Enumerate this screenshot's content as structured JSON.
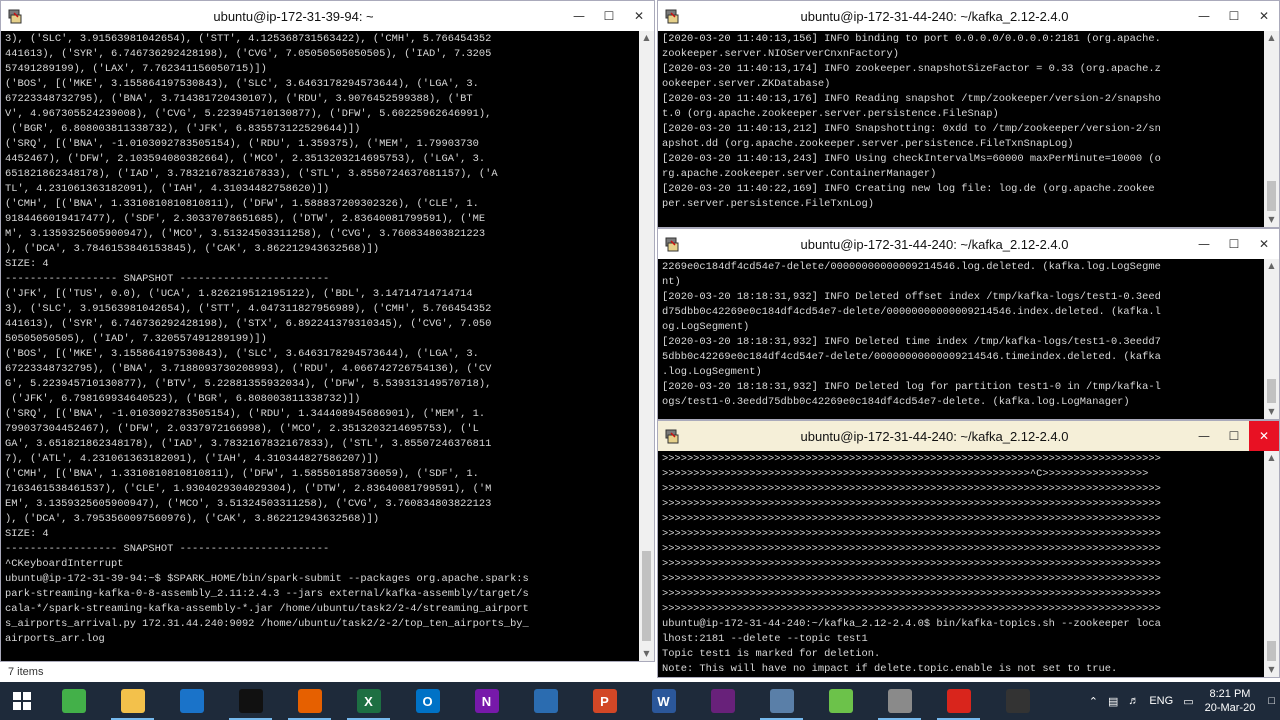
{
  "colors": {
    "terminal_bg": "#000000",
    "terminal_text": "#d9d9d9",
    "cursor": "#00e600",
    "taskbar": "#1e2a3a",
    "close_red": "#e81123",
    "active_title": "#f5efd8"
  },
  "window_left": {
    "title": "ubuntu@ip-172-31-39-94: ~",
    "icon": "putty-icon",
    "lines": [
      "3), ('SLC', 3.91563981042654), ('STT', 4.125368731563422), ('CMH', 5.766454352",
      "441613), ('SYR', 6.746736292428198), ('CVG', 7.05050505050505), ('IAD', 7.3205",
      "57491289199), ('LAX', 7.762341156050715)])",
      "('BOS', [('MKE', 3.155864197530843), ('SLC', 3.6463178294573644), ('LGA', 3.",
      "67223348732795), ('BNA', 3.714381720430107), ('RDU', 3.9076452599388), ('BT",
      "V', 4.967305524239008), ('CVG', 5.223945710130877), ('DFW', 5.60225962646991),",
      " ('BGR', 6.808003811338732), ('JFK', 6.835573122529644)])",
      "('SRQ', [('BNA', -1.0103092783505154), ('RDU', 1.359375), ('MEM', 1.79903730",
      "4452467), ('DFW', 2.103594080382664), ('MCO', 2.3513203214695753), ('LGA', 3.",
      "651821862348178), ('IAD', 3.7832167832167833), ('STL', 3.8550724637681157), ('A",
      "TL', 4.231061363182091), ('IAH', 4.31034482758620)])",
      "('CMH', [('BNA', 1.3310810810810811), ('DFW', 1.588837209302326), ('CLE', 1.",
      "9184466019417477), ('SDF', 2.30337078651685), ('DTW', 2.83640081799591), ('ME",
      "M', 3.1359325605900947), ('MCO', 3.51324503311258), ('CVG', 3.760834803821223",
      "), ('DCA', 3.7846153846153845), ('CAK', 3.862212943632568)])",
      "SIZE: 4",
      "------------------ SNAPSHOT ------------------------",
      "('JFK', [('TUS', 0.0), ('UCA', 1.826219512195122), ('BDL', 3.14714714714714",
      "3), ('SLC', 3.91563981042654), ('STT', 4.047311827956989), ('CMH', 5.766454352",
      "441613), ('SYR', 6.746736292428198), ('STX', 6.892241379310345), ('CVG', 7.050",
      "50505050505), ('IAD', 7.320557491289199)])",
      "('BOS', [('MKE', 3.155864197530843), ('SLC', 3.6463178294573644), ('LGA', 3.",
      "67223348732795), ('BNA', 3.7188093730208993), ('RDU', 4.066742726754136), ('CV",
      "G', 5.223945710130877), ('BTV', 5.22881355932034), ('DFW', 5.539313149570718),",
      " ('JFK', 6.798169934640523), ('BGR', 6.808003811338732)])",
      "('SRQ', [('BNA', -1.0103092783505154), ('RDU', 1.344408945686901), ('MEM', 1.",
      "799037304452467), ('DFW', 2.0337972166998), ('MCO', 2.3513203214695753), ('L",
      "GA', 3.651821862348178), ('IAD', 3.7832167832167833), ('STL', 3.85507246376811",
      "7), ('ATL', 4.231061363182091), ('IAH', 4.310344827586207)])",
      "('CMH', [('BNA', 1.3310810810810811), ('DFW', 1.585501858736059), ('SDF', 1.",
      "7163461538461537), ('CLE', 1.9304029304029304), ('DTW', 2.83640081799591), ('M",
      "EM', 3.1359325605900947), ('MCO', 3.51324503311258), ('CVG', 3.760834803822123",
      "), ('DCA', 3.7953560097560976), ('CAK', 3.862212943632568)])",
      "SIZE: 4",
      "------------------ SNAPSHOT ------------------------",
      "^CKeyboardInterrupt",
      "ubuntu@ip-172-31-39-94:~$ $SPARK_HOME/bin/spark-submit --packages org.apache.spark:s",
      "park-streaming-kafka-0-8-assembly_2.11:2.4.3 --jars external/kafka-assembly/target/s",
      "cala-*/spark-streaming-kafka-assembly-*.jar /home/ubuntu/task2/2-4/streaming_airport",
      "s_airports_arrival.py 172.31.44.240:9092 /home/ubuntu/task2/2-2/top_ten_airports_by_",
      "airports_arr.log"
    ]
  },
  "window_zk": {
    "title": "ubuntu@ip-172-31-44-240: ~/kafka_2.12-2.4.0",
    "lines": [
      "[2020-03-20 11:40:13,156] INFO binding to port 0.0.0.0/0.0.0.0:2181 (org.apache.",
      "zookeeper.server.NIOServerCnxnFactory)",
      "[2020-03-20 11:40:13,174] INFO zookeeper.snapshotSizeFactor = 0.33 (org.apache.z",
      "ookeeper.server.ZKDatabase)",
      "[2020-03-20 11:40:13,176] INFO Reading snapshot /tmp/zookeeper/version-2/snapsho",
      "t.0 (org.apache.zookeeper.server.persistence.FileSnap)",
      "[2020-03-20 11:40:13,212] INFO Snapshotting: 0xdd to /tmp/zookeeper/version-2/sn",
      "apshot.dd (org.apache.zookeeper.server.persistence.FileTxnSnapLog)",
      "[2020-03-20 11:40:13,243] INFO Using checkIntervalMs=60000 maxPerMinute=10000 (o",
      "rg.apache.zookeeper.server.ContainerManager)",
      "[2020-03-20 11:40:22,169] INFO Creating new log file: log.de (org.apache.zookee",
      "per.server.persistence.FileTxnLog)"
    ]
  },
  "window_kafka": {
    "title": "ubuntu@ip-172-31-44-240: ~/kafka_2.12-2.4.0",
    "lines": [
      "2269e0c184df4cd54e7-delete/00000000000009214546.log.deleted. (kafka.log.LogSegme",
      "nt)",
      "[2020-03-20 18:18:31,932] INFO Deleted offset index /tmp/kafka-logs/test1-0.3eed",
      "d75dbb0c42269e0c184df4cd54e7-delete/00000000000009214546.index.deleted. (kafka.l",
      "og.LogSegment)",
      "[2020-03-20 18:18:31,932] INFO Deleted time index /tmp/kafka-logs/test1-0.3eedd7",
      "5dbb0c42269e0c184df4cd54e7-delete/00000000000009214546.timeindex.deleted. (kafka",
      ".log.LogSegment)",
      "[2020-03-20 18:18:31,932] INFO Deleted log for partition test1-0 in /tmp/kafka-l",
      "ogs/test1-0.3eedd75dbb0c42269e0c184df4cd54e7-delete. (kafka.log.LogManager)"
    ]
  },
  "window_topics": {
    "title": "ubuntu@ip-172-31-44-240: ~/kafka_2.12-2.4.0",
    "lines": [
      ">>>>>>>>>>>>>>>>>>>>>>>>>>>>>>>>>>>>>>>>>>>>>>>>>>>>>>>>>>>>>>>>>>>>>>>>>>>>>>>>",
      ">>>>>>>>>>>>>>>>>>>>>>>>>>>>>>>>>>>>>>>>>>>>>>>>>>>>>>>>>>>^C>>>>>>>>>>>>>>>>>",
      ">>>>>>>>>>>>>>>>>>>>>>>>>>>>>>>>>>>>>>>>>>>>>>>>>>>>>>>>>>>>>>>>>>>>>>>>>>>>>>>>",
      ">>>>>>>>>>>>>>>>>>>>>>>>>>>>>>>>>>>>>>>>>>>>>>>>>>>>>>>>>>>>>>>>>>>>>>>>>>>>>>>>",
      ">>>>>>>>>>>>>>>>>>>>>>>>>>>>>>>>>>>>>>>>>>>>>>>>>>>>>>>>>>>>>>>>>>>>>>>>>>>>>>>>",
      ">>>>>>>>>>>>>>>>>>>>>>>>>>>>>>>>>>>>>>>>>>>>>>>>>>>>>>>>>>>>>>>>>>>>>>>>>>>>>>>>",
      ">>>>>>>>>>>>>>>>>>>>>>>>>>>>>>>>>>>>>>>>>>>>>>>>>>>>>>>>>>>>>>>>>>>>>>>>>>>>>>>>",
      ">>>>>>>>>>>>>>>>>>>>>>>>>>>>>>>>>>>>>>>>>>>>>>>>>>>>>>>>>>>>>>>>>>>>>>>>>>>>>>>>",
      ">>>>>>>>>>>>>>>>>>>>>>>>>>>>>>>>>>>>>>>>>>>>>>>>>>>>>>>>>>>>>>>>>>>>>>>>>>>>>>>>",
      ">>>>>>>>>>>>>>>>>>>>>>>>>>>>>>>>>>>>>>>>>>>>>>>>>>>>>>>>>>>>>>>>>>>>>>>>>>>>>>>>",
      ">>>>>>>>>>>>>>>>>>>>>>>>>>>>>>>>>>>>>>>>>>>>>>>>>>>>>>>>>>>>>>>>>>>>>>>>>>>>>>>>",
      "ubuntu@ip-172-31-44-240:~/kafka_2.12-2.4.0$ bin/kafka-topics.sh --zookeeper loca",
      "lhost:2181 --delete --topic test1",
      "Topic test1 is marked for deletion.",
      "Note: This will have no impact if delete.topic.enable is not set to true."
    ],
    "prompt": "ubuntu@ip-172-31-44-240:~/kafka_2.12-2.4.0$ "
  },
  "explorer_status": "7 items",
  "taskbar": {
    "apps": [
      {
        "name": "windows-start-icon",
        "label": ""
      },
      {
        "name": "anaconda-icon",
        "label": ""
      },
      {
        "name": "file-explorer-icon",
        "label": ""
      },
      {
        "name": "azure-icon",
        "label": ""
      },
      {
        "name": "terminal-icon",
        "label": ""
      },
      {
        "name": "firefox-icon",
        "label": ""
      },
      {
        "name": "excel-icon",
        "label": "X"
      },
      {
        "name": "outlook-icon",
        "label": "O"
      },
      {
        "name": "onenote-icon",
        "label": "N"
      },
      {
        "name": "powershell-icon",
        "label": ""
      },
      {
        "name": "powerpoint-icon",
        "label": "P"
      },
      {
        "name": "word-icon",
        "label": "W"
      },
      {
        "name": "visual-studio-icon",
        "label": ""
      },
      {
        "name": "network-app-icon",
        "label": ""
      },
      {
        "name": "notepad-icon",
        "label": ""
      },
      {
        "name": "putty-icon",
        "label": ""
      },
      {
        "name": "acrobat-icon",
        "label": ""
      },
      {
        "name": "github-icon",
        "label": ""
      }
    ],
    "lang": "ENG",
    "time": "8:21 PM",
    "date": "20-Mar-20"
  }
}
